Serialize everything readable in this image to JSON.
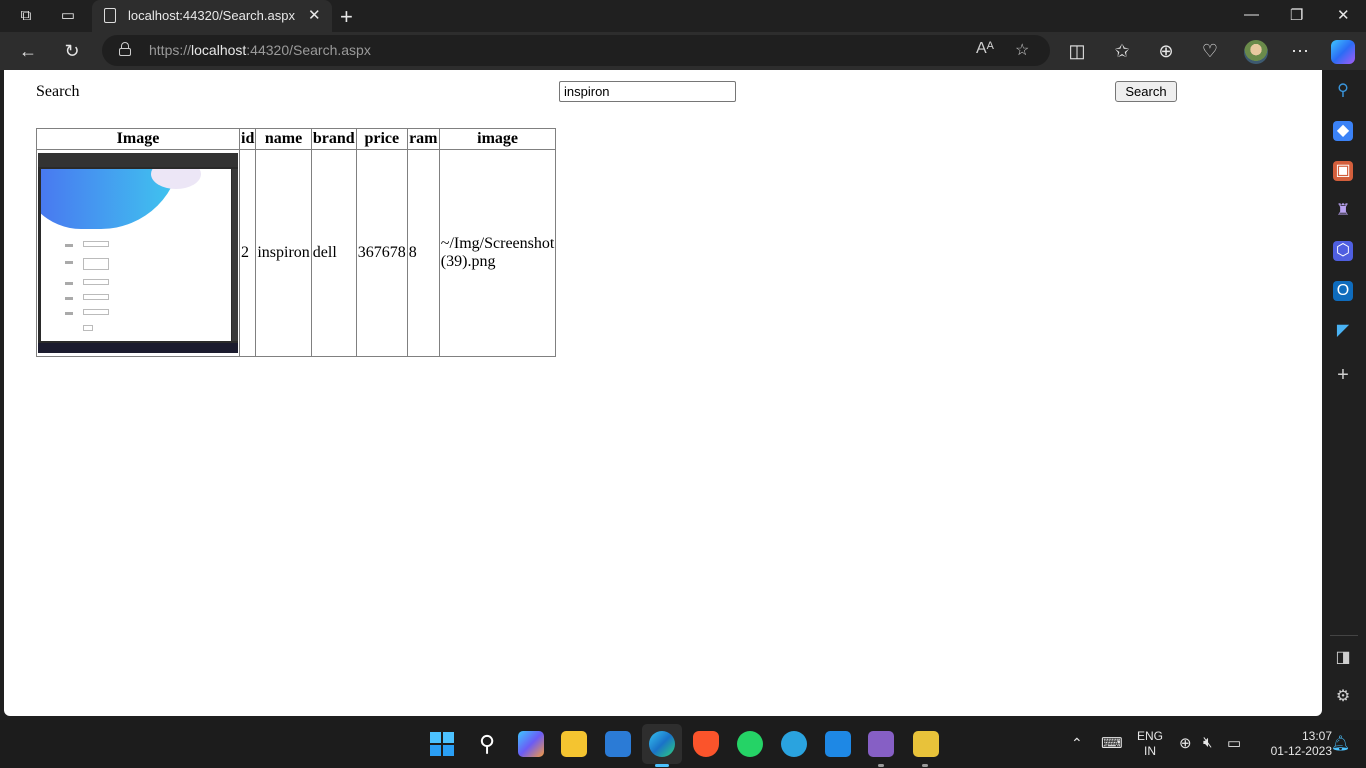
{
  "browser": {
    "tab_title": "localhost:44320/Search.aspx",
    "url_prefix": "https://",
    "url_host": "localhost",
    "url_rest": ":44320/Search.aspx"
  },
  "page": {
    "search_label": "Search",
    "search_value": "inspiron",
    "search_button": "Search",
    "table": {
      "headers": [
        "Image",
        "id",
        "name",
        "brand",
        "price",
        "ram",
        "image"
      ],
      "rows": [
        {
          "id": "2",
          "name": "inspiron",
          "brand": "dell",
          "price": "367678",
          "ram": "8",
          "image": "~/Img/Screenshot (39).png"
        }
      ]
    }
  },
  "taskbar": {
    "lang_top": "ENG",
    "lang_bottom": "IN",
    "time": "13:07",
    "date": "01-12-2023"
  },
  "colors": {
    "accent": "#3a96dd",
    "viewport_bg": "#ffffff",
    "chrome_bg": "#202020"
  }
}
